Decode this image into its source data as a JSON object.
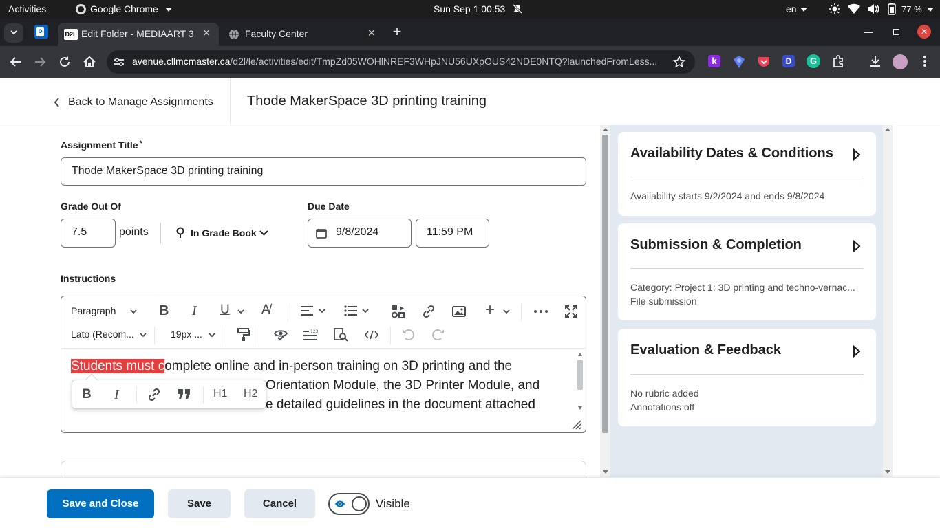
{
  "system_bar": {
    "activities": "Activities",
    "app_name": "Google Chrome",
    "datetime": "Sun Sep 1  00:53",
    "lang": "en",
    "battery": "77 %"
  },
  "browser": {
    "tabs": [
      {
        "label": "Edit Folder - MEDIAART 3",
        "active": true,
        "favicon": "D2L"
      },
      {
        "label": "Faculty Center",
        "active": false
      }
    ],
    "url_host": "avenue.cllmcmaster.ca",
    "url_path": "/d2l/le/activities/edit/TmpZd05WOHlNREF3WHpJNU56UXpOUS42NDE0NTQ?launchedFromLess..."
  },
  "header": {
    "back_label": "Back to Manage Assignments",
    "page_title": "Thode MakerSpace 3D printing training"
  },
  "form": {
    "title_label": "Assignment Title",
    "required_mark": "*",
    "title_value": "Thode MakerSpace 3D printing training",
    "grade_label": "Grade Out Of",
    "grade_value": "7.5",
    "grade_unit": "points",
    "gradebook_label": "In Grade Book",
    "due_label": "Due Date",
    "due_date": "9/8/2024",
    "due_time": "11:59 PM",
    "instructions_label": "Instructions"
  },
  "editor": {
    "paragraph_select": "Paragraph",
    "font_select": "Lato (Recom...",
    "size_select": "19px ...",
    "highlighted_text": "Students must c",
    "line1_rest": "omplete online and in-person training on 3D printing and the",
    "line2_visible": "Orientation Module, the 3D Printer Module, and",
    "line3_visible": "e detailed guidelines in the document attached",
    "float_h1": "H1",
    "float_h2": "H2"
  },
  "side_panels": [
    {
      "title": "Availability Dates & Conditions",
      "lines": [
        "Availability starts 9/2/2024 and ends 9/8/2024"
      ]
    },
    {
      "title": "Submission & Completion",
      "lines": [
        "Category: Project 1: 3D printing and techno-vernac...",
        "File submission"
      ]
    },
    {
      "title": "Evaluation & Feedback",
      "lines": [
        "No rubric added",
        "Annotations off"
      ]
    }
  ],
  "footer": {
    "save_close": "Save and Close",
    "save": "Save",
    "cancel": "Cancel",
    "visible_label": "Visible"
  },
  "colors": {
    "primary": "#006fbf",
    "highlight": "#e53e3e",
    "side_bg": "#e3e9f1",
    "close_red": "#e0443e"
  }
}
